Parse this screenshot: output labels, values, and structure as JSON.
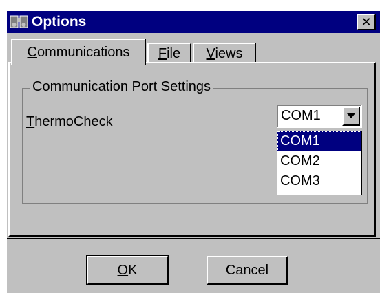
{
  "window": {
    "title": "Options",
    "close_glyph": "✕"
  },
  "tabs": [
    {
      "label_accel": "C",
      "label_rest": "ommunications",
      "active": true
    },
    {
      "label_accel": "F",
      "label_rest": "ile",
      "active": false
    },
    {
      "label_accel": "V",
      "label_rest": "iews",
      "active": false
    }
  ],
  "group": {
    "title": "Communication Port Settings"
  },
  "field": {
    "label_accel": "T",
    "label_rest": "hermoCheck",
    "value": "COM1",
    "options": [
      "COM1",
      "COM2",
      "COM3"
    ]
  },
  "buttons": {
    "ok_accel": "O",
    "ok_rest": "K",
    "cancel": "Cancel"
  },
  "colors": {
    "titlebar": "#000080",
    "face": "#c0c0c0",
    "highlight": "#000080"
  },
  "icons": {
    "title": "binoculars-icon",
    "close": "close-icon",
    "dropdown": "chevron-down-icon"
  }
}
